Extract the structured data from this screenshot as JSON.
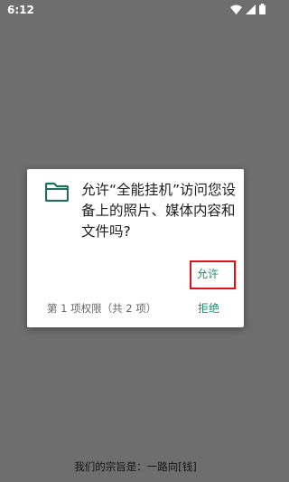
{
  "status_bar": {
    "time": "6:12",
    "icons": [
      "wifi-icon",
      "signal-icon",
      "battery-icon"
    ]
  },
  "dialog": {
    "icon": "folder-icon",
    "message": "允许“全能挂机”访问您设备上的照片、媒体内容和文件吗?",
    "allow_label": "允许",
    "deny_label": "拒绝",
    "permission_count": "第 1 项权限（共 2 项）"
  },
  "caption": {
    "text": "我们的宗旨是：一路向[钱]"
  },
  "colors": {
    "overlay": "#6e6e6e",
    "accent": "#1f8a70",
    "highlight": "#d9141c"
  }
}
